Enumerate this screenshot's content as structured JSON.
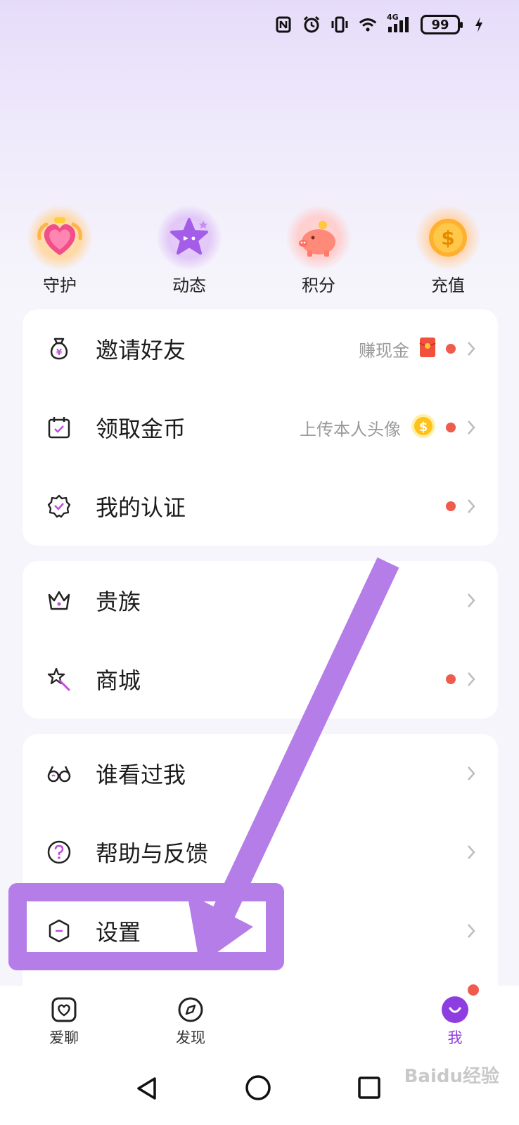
{
  "status_bar": {
    "battery": "99",
    "icons": [
      "nfc-icon",
      "alarm-icon",
      "vibrate-icon",
      "wifi-icon",
      "signal-4g-icon",
      "battery-icon",
      "charging-icon"
    ],
    "network_label": "4G"
  },
  "quick_actions": [
    {
      "label": "守护",
      "icon": "guard-heart-icon"
    },
    {
      "label": "动态",
      "icon": "star-icon"
    },
    {
      "label": "积分",
      "icon": "piggy-bank-icon"
    },
    {
      "label": "充值",
      "icon": "coin-icon"
    }
  ],
  "menu": {
    "group1": [
      {
        "label": "邀请好友",
        "hint": "赚现金",
        "icon": "money-bag-icon",
        "has_dot": true
      },
      {
        "label": "领取金币",
        "hint": "上传本人头像",
        "icon": "calendar-check-icon",
        "has_dot": true
      },
      {
        "label": "我的认证",
        "hint": "",
        "icon": "verified-badge-icon",
        "has_dot": true
      }
    ],
    "group2": [
      {
        "label": "贵族",
        "icon": "crown-icon",
        "has_dot": false
      },
      {
        "label": "商城",
        "icon": "magic-wand-icon",
        "has_dot": true
      }
    ],
    "group3": [
      {
        "label": "谁看过我",
        "icon": "glasses-icon",
        "has_dot": false
      },
      {
        "label": "帮助与反馈",
        "icon": "help-icon",
        "has_dot": false
      },
      {
        "label": "设置",
        "icon": "settings-hexagon-icon",
        "has_dot": false
      }
    ]
  },
  "tabbar": {
    "tabs": [
      {
        "label": "爱聊",
        "icon": "chat-heart-icon"
      },
      {
        "label": "发现",
        "icon": "compass-icon"
      },
      {
        "label": "我",
        "icon": "profile-smile-icon",
        "active": true
      }
    ]
  },
  "watermark": "Baidu经验",
  "colors": {
    "accent": "#8e3ee0",
    "red_dot": "#ef5b4c",
    "annotation": "#b57de8"
  }
}
